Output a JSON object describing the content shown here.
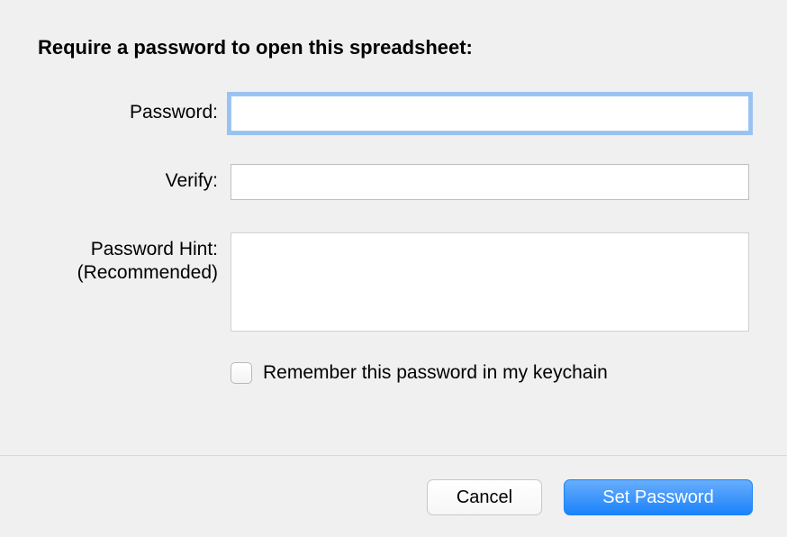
{
  "title": "Require a password to open this spreadsheet:",
  "fields": {
    "password": {
      "label": "Password:",
      "value": ""
    },
    "verify": {
      "label": "Verify:",
      "value": ""
    },
    "hint": {
      "label_line1": "Password Hint:",
      "label_line2": "(Recommended)",
      "value": ""
    }
  },
  "checkbox": {
    "label": "Remember this password in my keychain",
    "checked": false
  },
  "buttons": {
    "cancel": "Cancel",
    "set_password": "Set Password"
  }
}
